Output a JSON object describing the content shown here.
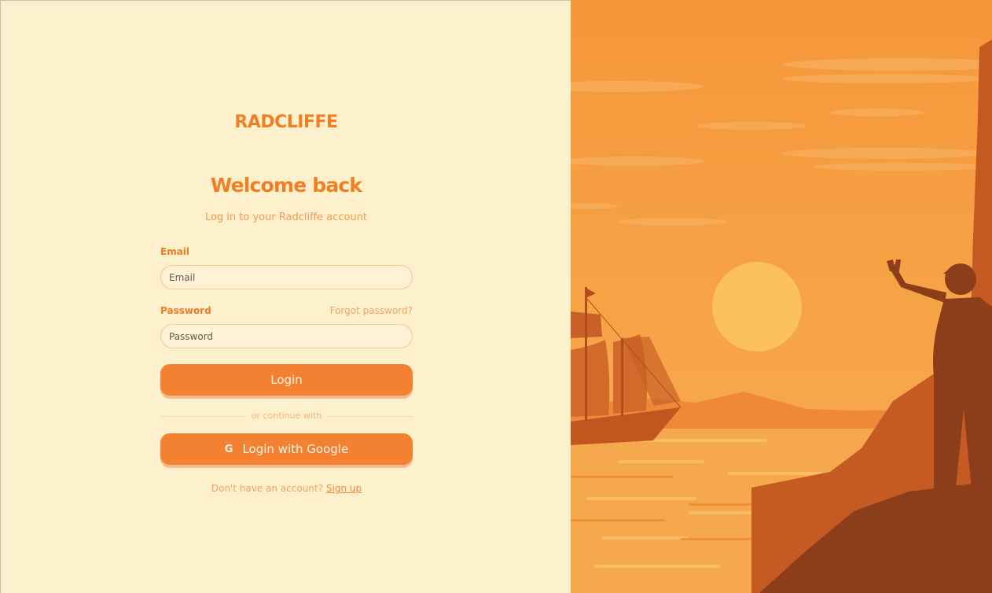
{
  "brand": {
    "logo_text": "RADCLIFFE"
  },
  "header": {
    "title": "Welcome back",
    "subtitle": "Log in to your Radcliffe account"
  },
  "form": {
    "email": {
      "label": "Email",
      "placeholder": "Email",
      "value": ""
    },
    "password": {
      "label": "Password",
      "placeholder": "Password",
      "value": "",
      "forgot_label": "Forgot password?"
    },
    "login_label": "Login",
    "divider_text": "or continue with",
    "google_label": "Login with Google",
    "google_icon": "google-icon"
  },
  "footer": {
    "prompt": "Don't have an account?",
    "signup_label": "Sign up"
  },
  "colors": {
    "accent": "#f48131",
    "background": "#fdf0cc",
    "sky": "#f59a3a",
    "sun": "#fcc15c",
    "silhouette": "#8c3d1a"
  },
  "illustration": {
    "name": "sunset-cliff-ship-illustration"
  }
}
